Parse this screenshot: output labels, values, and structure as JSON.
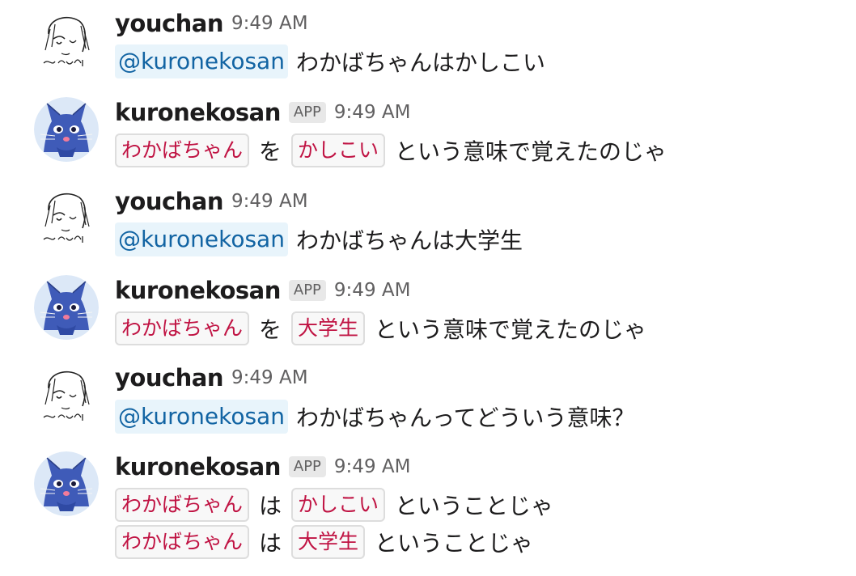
{
  "messages": [
    {
      "author": "youchan",
      "time": "9:49 AM",
      "mention": "@kuronekosan",
      "text": "わかばちゃんはかしこい"
    },
    {
      "author": "kuronekosan",
      "badge": "APP",
      "time": "9:49 AM",
      "line": {
        "code1": "わかばちゃん",
        "particle": "を",
        "code2": "かしこい",
        "tail": "という意味で覚えたのじゃ"
      }
    },
    {
      "author": "youchan",
      "time": "9:49 AM",
      "mention": "@kuronekosan",
      "text": "わかばちゃんは大学生"
    },
    {
      "author": "kuronekosan",
      "badge": "APP",
      "time": "9:49 AM",
      "line": {
        "code1": "わかばちゃん",
        "particle": "を",
        "code2": "大学生",
        "tail": "という意味で覚えたのじゃ"
      }
    },
    {
      "author": "youchan",
      "time": "9:49 AM",
      "mention": "@kuronekosan",
      "text": "わかばちゃんってどういう意味？"
    },
    {
      "author": "kuronekosan",
      "badge": "APP",
      "time": "9:49 AM",
      "lines": [
        {
          "code1": "わかばちゃん",
          "particle": "は",
          "code2": "かしこい",
          "tail": "ということじゃ"
        },
        {
          "code1": "わかばちゃん",
          "particle": "は",
          "code2": "大学生",
          "tail": "ということじゃ"
        }
      ]
    }
  ],
  "icons": {
    "user_avatar": "youchan-avatar-sketch",
    "bot_avatar": "kuronekosan-cat-avatar"
  },
  "colors": {
    "mention_text": "#1264a3",
    "mention_bg": "#e8f4fb",
    "code_text": "#c01343",
    "bot_avatar_bg": "#dce8f7",
    "cat_body": "#3f5bb8"
  }
}
